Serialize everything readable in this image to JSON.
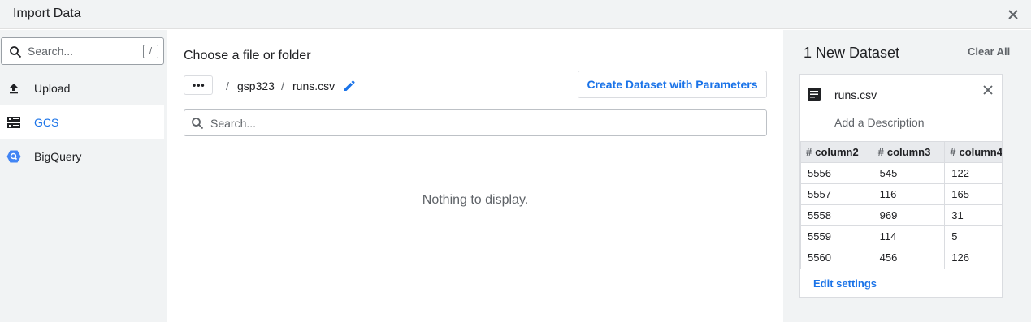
{
  "window": {
    "title": "Import Data"
  },
  "sidebar": {
    "search_placeholder": "Search...",
    "shortcut_key": "/",
    "items": [
      {
        "label": "Upload",
        "icon": "upload-icon",
        "active": false
      },
      {
        "label": "GCS",
        "icon": "storage-icon",
        "active": true
      },
      {
        "label": "BigQuery",
        "icon": "bigquery-icon",
        "active": false
      }
    ]
  },
  "main": {
    "heading": "Choose a file or folder",
    "more_label": "•••",
    "breadcrumb": [
      {
        "label": "gsp323"
      },
      {
        "label": "runs.csv"
      }
    ],
    "separator": "/",
    "create_button": "Create Dataset with Parameters",
    "search_placeholder": "Search...",
    "empty_message": "Nothing to display."
  },
  "panel": {
    "heading": "1 New Dataset",
    "clear_all": "Clear All",
    "dataset": {
      "file_name": "runs.csv",
      "description_placeholder": "Add a Description",
      "columns": [
        "column2",
        "column3",
        "column4"
      ],
      "rows": [
        [
          "5556",
          "545",
          "122"
        ],
        [
          "5557",
          "116",
          "165"
        ],
        [
          "5558",
          "969",
          "31"
        ],
        [
          "5559",
          "114",
          "5"
        ],
        [
          "5560",
          "456",
          "126"
        ],
        [
          "",
          "",
          ""
        ]
      ],
      "edit_settings": "Edit settings"
    }
  },
  "colors": {
    "accent": "#1a73e8",
    "panel_bg": "#f1f3f4",
    "text": "#202124"
  }
}
